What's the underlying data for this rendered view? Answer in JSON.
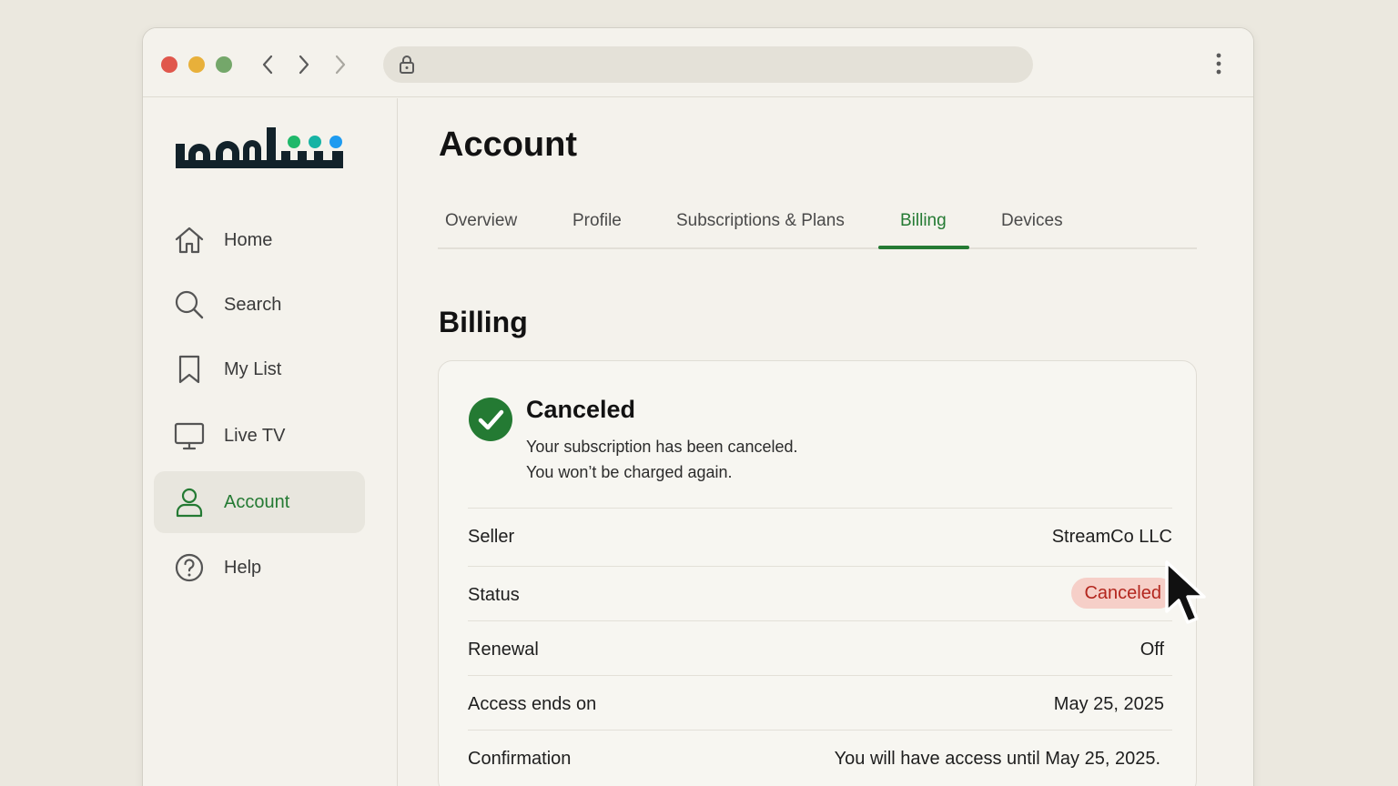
{
  "browser": {
    "address_value": "",
    "icons": [
      "close-dot",
      "minimize-dot",
      "maximize-dot",
      "back-arrow-icon",
      "forward-arrow-icon",
      "lock-icon",
      "kebab-menu-icon"
    ]
  },
  "brand": {
    "logo_text": "شاهد",
    "dot_colors": [
      "#1fb86a",
      "#16b3a4",
      "#1e9bf0"
    ]
  },
  "sidebar": {
    "items": [
      {
        "label": "Home",
        "icon": "home-icon"
      },
      {
        "label": "Search",
        "icon": "search-icon"
      },
      {
        "label": "My List",
        "icon": "bookmark-icon"
      },
      {
        "label": "Live TV",
        "icon": "monitor-icon"
      },
      {
        "label": "Account",
        "icon": "user-icon",
        "active": true
      },
      {
        "label": "Help",
        "icon": "help-icon"
      }
    ]
  },
  "page": {
    "title": "Account",
    "tabs": [
      {
        "label": "Overview"
      },
      {
        "label": "Profile"
      },
      {
        "label": "Subscriptions & Plans"
      },
      {
        "label": "Billing",
        "active": true
      },
      {
        "label": "Devices"
      }
    ]
  },
  "billing": {
    "section_title": "Billing",
    "status_title": "Canceled",
    "status_line1": "Your subscription has been canceled.",
    "status_line2": "You won’t be charged again.",
    "rows": [
      {
        "label": "Seller",
        "value": "StreamCo LLC"
      },
      {
        "label": "Status",
        "value": "Canceled"
      },
      {
        "label": "Renewal",
        "value": "Off"
      },
      {
        "label": "Access ends on",
        "value": "May 25, 2025"
      },
      {
        "label": "Confirmation",
        "value": "You will have access until May 25, 2025."
      }
    ]
  },
  "colors": {
    "accent": "#247a33",
    "badge_bg": "#f6cfc8",
    "badge_text": "#b3261e",
    "background": "#f4f2ec"
  }
}
